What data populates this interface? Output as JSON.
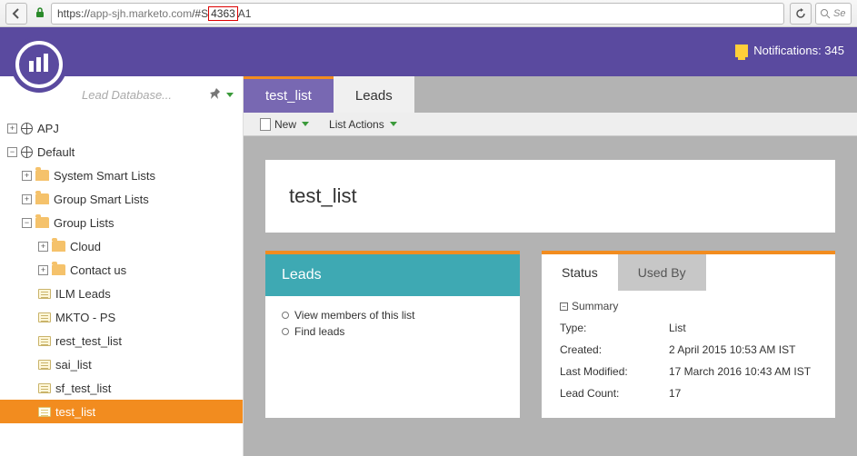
{
  "browser": {
    "url_prefix": "https://",
    "url_host": "app-sjh.marketo.com",
    "url_path_before": "/#S",
    "url_highlight": "4363",
    "url_path_after": "A1",
    "search_placeholder": "Se"
  },
  "header": {
    "notifications_label": "Notifications: 345"
  },
  "sidebar": {
    "search_placeholder": "Lead Database...",
    "tree": {
      "apj": "APJ",
      "default": "Default",
      "system_smart_lists": "System Smart Lists",
      "group_smart_lists": "Group Smart Lists",
      "group_lists": "Group Lists",
      "cloud": "Cloud",
      "contact_us": "Contact us",
      "ilm_leads": "ILM Leads",
      "mkto_ps": "MKTO - PS",
      "rest_test_list": "rest_test_list",
      "sai_list": "sai_list",
      "sf_test_list": "sf_test_list",
      "test_list": "test_list"
    }
  },
  "tabs": {
    "active": "test_list",
    "second": "Leads"
  },
  "actionbar": {
    "new": "New",
    "list_actions": "List Actions"
  },
  "title": "test_list",
  "leads_panel": {
    "heading": "Leads",
    "view_members": "View members of this list",
    "find_leads": "Find leads"
  },
  "status_panel": {
    "tab_status": "Status",
    "tab_usedby": "Used By",
    "summary": "Summary",
    "rows": {
      "type_k": "Type:",
      "type_v": "List",
      "created_k": "Created:",
      "created_v": "2 April 2015 10:53 AM IST",
      "modified_k": "Last Modified:",
      "modified_v": "17 March 2016 10:43 AM IST",
      "count_k": "Lead Count:",
      "count_v": "17"
    }
  }
}
